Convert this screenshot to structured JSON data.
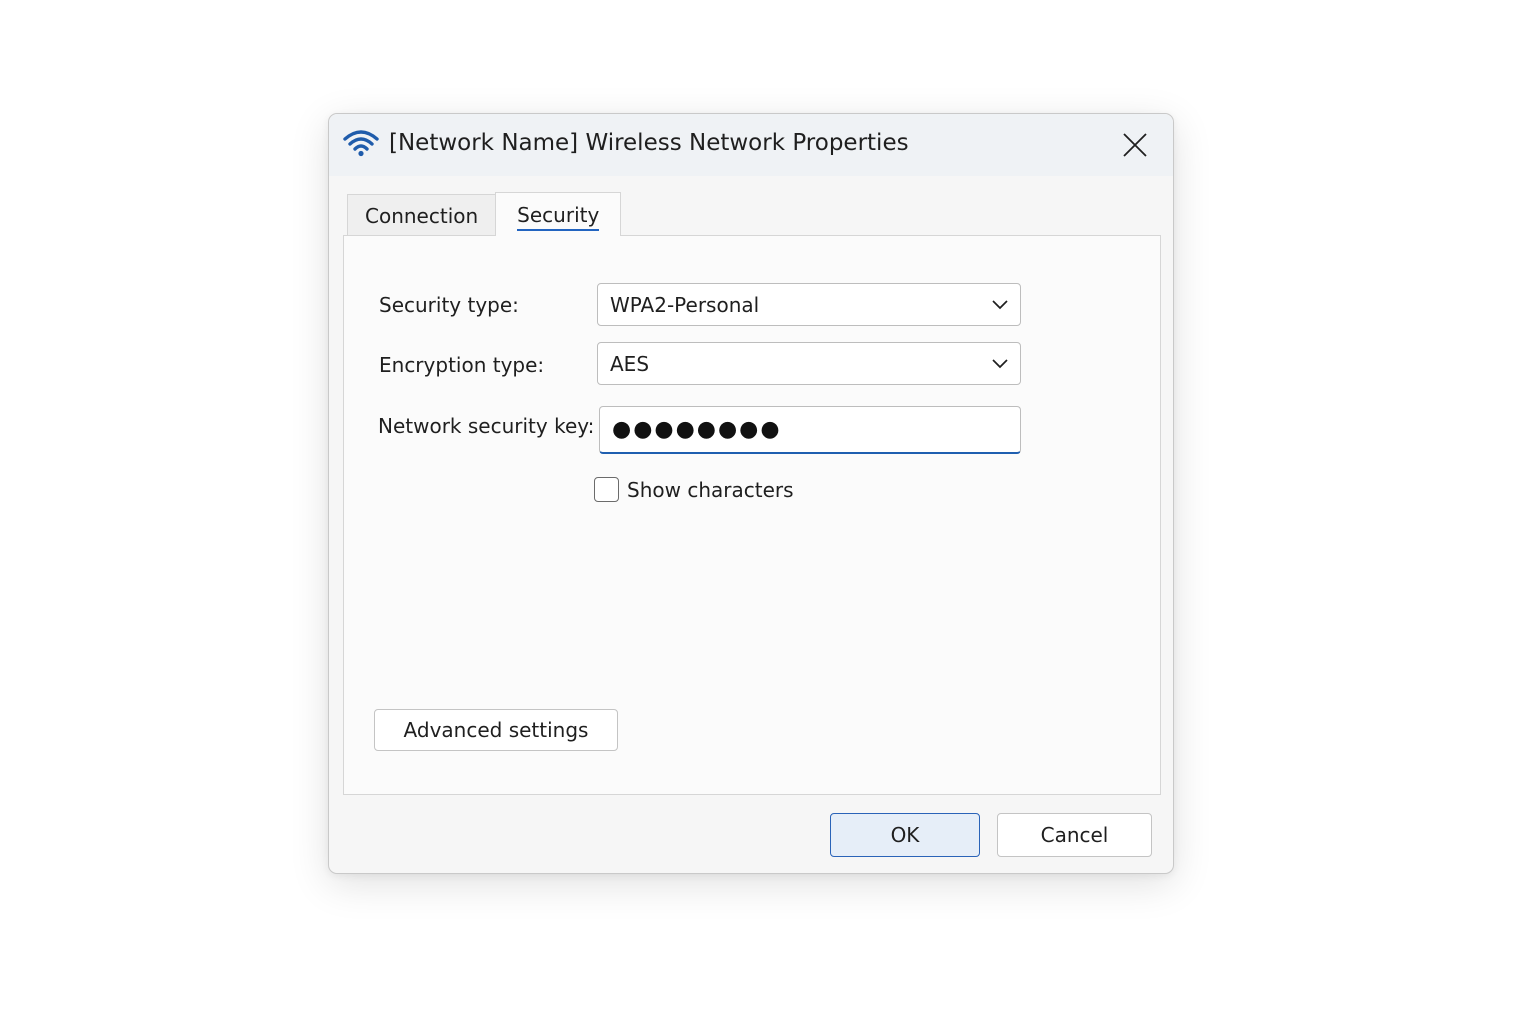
{
  "window": {
    "title": "[Network Name] Wireless Network Properties",
    "icon": "wifi-icon",
    "close_icon": "close-icon"
  },
  "tabs": [
    {
      "label": "Connection",
      "active": false
    },
    {
      "label": "Security",
      "active": true
    }
  ],
  "security": {
    "security_type_label": "Security type:",
    "security_type_value": "WPA2-Personal",
    "encryption_type_label": "Encryption type:",
    "encryption_type_value": "AES",
    "key_label": "Network security key:",
    "key_value": "●●●●●●●●",
    "show_characters_label": "Show characters",
    "show_characters_checked": false,
    "advanced_settings_label": "Advanced settings"
  },
  "footer": {
    "ok_label": "OK",
    "cancel_label": "Cancel"
  },
  "colors": {
    "accent": "#2264c0",
    "wifi": "#1f5cab"
  }
}
